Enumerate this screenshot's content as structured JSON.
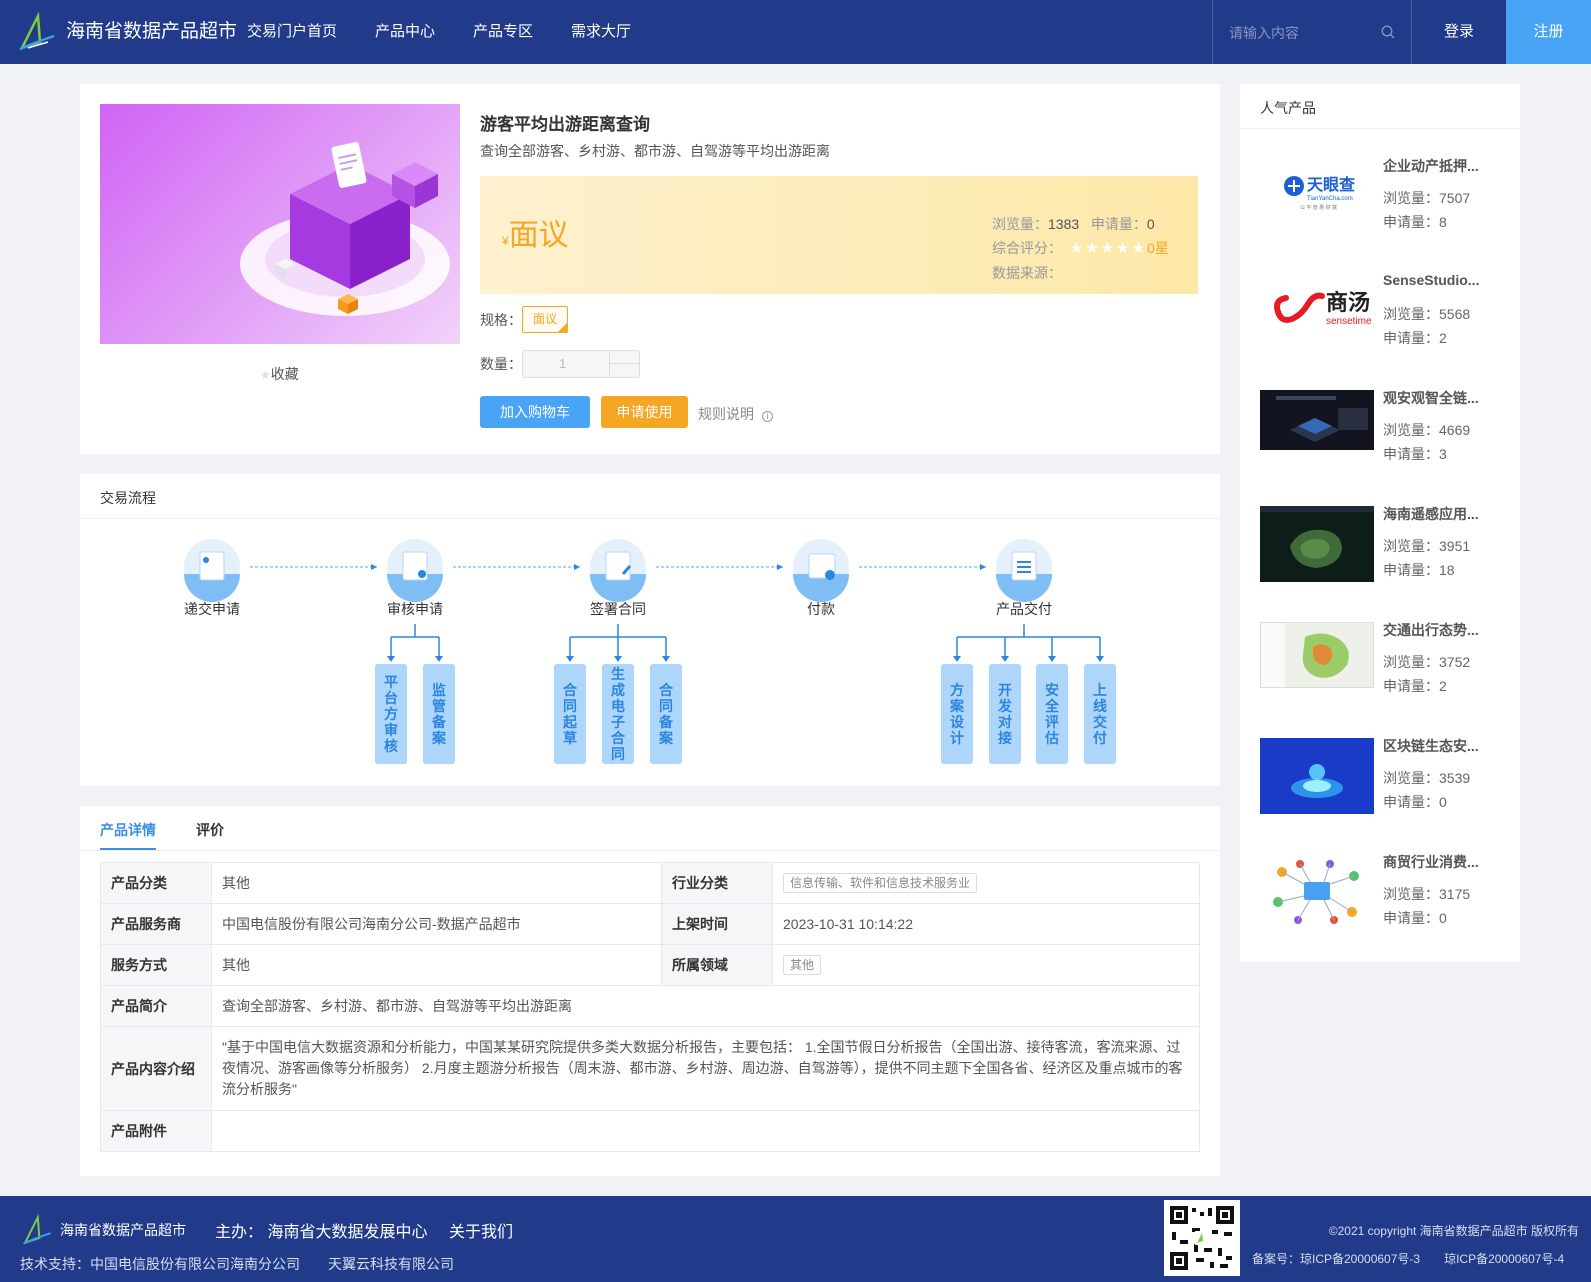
{
  "nav": {
    "brand": "海南省数据产品超市",
    "links": [
      "交易门户首页",
      "产品中心",
      "产品专区",
      "需求大厅"
    ],
    "search_placeholder": "请输入内容",
    "login": "登录",
    "register": "注册"
  },
  "product": {
    "title": "游客平均出游距离查询",
    "desc": "查询全部游客、乡村游、都市游、自驾游等平均出游距离",
    "currency": "¥",
    "price": "面议",
    "views_label": "浏览量：",
    "views": "1383",
    "apply_label": "申请量：",
    "applies": "0",
    "rating_label": "综合评分：",
    "stars": "★★★★★",
    "rating": "0星",
    "source_label": "数据来源：",
    "spec_label": "规格：",
    "spec_value": "面议",
    "qty_label": "数量：",
    "qty_value": "1",
    "cart_btn": "加入购物车",
    "apply_btn": "申请使用",
    "rule": "规则说明",
    "favorite": "收藏"
  },
  "flow": {
    "title": "交易流程",
    "steps": [
      "递交申请",
      "审核申请",
      "签署合同",
      "付款",
      "产品交付"
    ],
    "sub1": [
      "平台方审核",
      "监管备案"
    ],
    "sub2": [
      "合同起草",
      "生成电子合同",
      "合同备案"
    ],
    "sub3": [
      "方案设计",
      "开发对接",
      "安全评估",
      "上线交付"
    ]
  },
  "details": {
    "tabs": [
      "产品详情",
      "评价"
    ],
    "rows": {
      "category_k": "产品分类",
      "category_v": "其他",
      "industry_k": "行业分类",
      "industry_v": "信息传输、软件和信息技术服务业",
      "provider_k": "产品服务商",
      "provider_v": "中国电信股份有限公司海南分公司-数据产品超市",
      "listed_k": "上架时间",
      "listed_v": "2023-10-31 10:14:22",
      "service_k": "服务方式",
      "service_v": "其他",
      "domain_k": "所属领域",
      "domain_v": "其他",
      "intro_k": "产品简介",
      "intro_v": "查询全部游客、乡村游、都市游、自驾游等平均出游距离",
      "content_k": "产品内容介绍",
      "content_v": "\"基于中国电信大数据资源和分析能力，中国某某研究院提供多类大数据分析报告，主要包括： 1.全国节假日分析报告（全国出游、接待客流，客流来源、过夜情况、游客画像等分析服务） 2.月度主题游分析报告（周末游、都市游、乡村游、周边游、自驾游等），提供不同主题下全国各省、经济区及重点城市的客流分析服务\"",
      "attach_k": "产品附件",
      "attach_v": ""
    }
  },
  "popular": {
    "title": "人气产品",
    "views_label": "浏览量：",
    "apply_label": "申请量：",
    "items": [
      {
        "name": "企业动产抵押...",
        "views": "7507",
        "applies": "8"
      },
      {
        "name": "SenseStudio...",
        "views": "5568",
        "applies": "2"
      },
      {
        "name": "观安观智全链...",
        "views": "4669",
        "applies": "3"
      },
      {
        "name": "海南遥感应用...",
        "views": "3951",
        "applies": "18"
      },
      {
        "name": "交通出行态势...",
        "views": "3752",
        "applies": "2"
      },
      {
        "name": "区块链生态安...",
        "views": "3539",
        "applies": "0"
      },
      {
        "name": "商贸行业消费...",
        "views": "3175",
        "applies": "0"
      }
    ],
    "logo_text": [
      "天眼查",
      "TianYanCha.com",
      "公 平 普 惠 财 富",
      "商汤",
      "sensetime"
    ]
  },
  "footer": {
    "brand": "海南省数据产品超市",
    "host": "主办： 海南省大数据发展中心",
    "about": "关于我们",
    "support": "技术支持：中国电信股份有限公司海南分公司　　天翼云科技有限公司",
    "copyright": "©2021 copyright 海南省数据产品超市 版权所有",
    "icp": "备案号：琼ICP备20000607号-3　　琼ICP备20000607号-4"
  }
}
